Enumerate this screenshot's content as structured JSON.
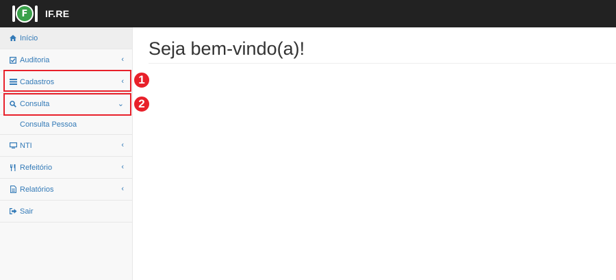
{
  "brand": {
    "name": "IF.RE",
    "logo_char": "F"
  },
  "sidebar": {
    "items": [
      {
        "label": "Início",
        "icon": "home-icon"
      },
      {
        "label": "Auditoria",
        "icon": "check-square-icon",
        "chevron": "‹"
      },
      {
        "label": "Cadastros",
        "icon": "list-icon",
        "chevron": "‹"
      },
      {
        "label": "Consulta",
        "icon": "search-icon",
        "chevron": "⌄"
      },
      {
        "label": "NTI",
        "icon": "monitor-icon",
        "chevron": "‹"
      },
      {
        "label": "Refeitório",
        "icon": "cutlery-icon",
        "chevron": "‹"
      },
      {
        "label": "Relatórios",
        "icon": "file-text-icon",
        "chevron": "‹"
      },
      {
        "label": "Sair",
        "icon": "sign-out-icon"
      }
    ],
    "subitems": [
      {
        "label": "Consulta Pessoa"
      }
    ]
  },
  "annotations": [
    {
      "number": "1"
    },
    {
      "number": "2"
    }
  ],
  "main": {
    "title": "Seja bem-vindo(a)!"
  },
  "colors": {
    "topbar": "#222222",
    "link": "#337ab7",
    "highlight": "#e8202a",
    "logo_green": "#3aa14a"
  }
}
